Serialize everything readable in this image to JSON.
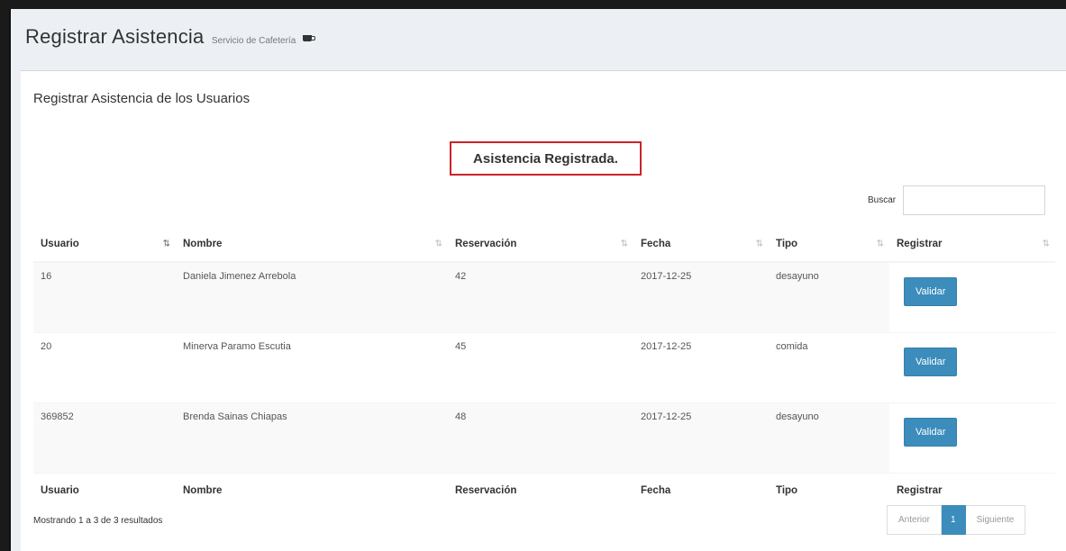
{
  "header": {
    "title": "Registrar Asistencia",
    "subtitle": "Servicio de Cafetería",
    "subtitle_icon": "coffee-icon"
  },
  "box": {
    "title": "Registrar Asistencia de los Usuarios"
  },
  "alert": {
    "message": "Asistencia Registrada.",
    "border_color": "#c9242b"
  },
  "search": {
    "label": "Buscar",
    "value": ""
  },
  "table": {
    "columns": [
      "Usuario",
      "Nombre",
      "Reservación",
      "Fecha",
      "Tipo",
      "Registrar"
    ],
    "sorted_column": "Usuario",
    "rows": [
      {
        "usuario": "16",
        "nombre": "Daniela Jimenez Arrebola",
        "reservacion": "42",
        "fecha": "2017-12-25",
        "tipo": "desayuno",
        "button": "Validar"
      },
      {
        "usuario": "20",
        "nombre": "Minerva Paramo Escutia",
        "reservacion": "45",
        "fecha": "2017-12-25",
        "tipo": "comida",
        "button": "Validar"
      },
      {
        "usuario": "369852",
        "nombre": "Brenda Sainas Chiapas",
        "reservacion": "48",
        "fecha": "2017-12-25",
        "tipo": "desayuno",
        "button": "Validar"
      }
    ]
  },
  "footer": {
    "info": "Mostrando 1 a 3 de 3 resultados",
    "pagination": {
      "previous": "Anterior",
      "current": "1",
      "next": "Siguiente"
    }
  },
  "colors": {
    "primary": "#3c8dbc",
    "background": "#ecf0f5"
  }
}
